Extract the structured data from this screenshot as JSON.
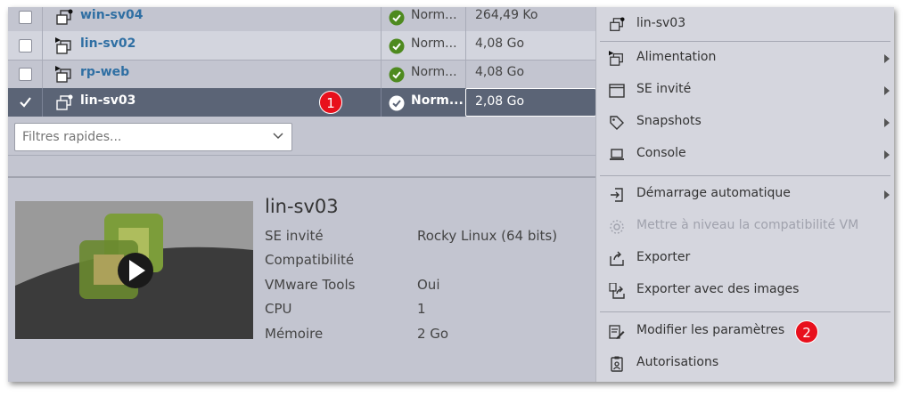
{
  "table": {
    "rows": [
      {
        "name": "win-sv04",
        "status": "Norm...",
        "size": "264,49 Ko",
        "checked": false,
        "selected": false
      },
      {
        "name": "lin-sv02",
        "status": "Norm...",
        "size": "4,08 Go",
        "checked": false,
        "selected": false
      },
      {
        "name": "rp-web",
        "status": "Norm...",
        "size": "4,08 Go",
        "checked": false,
        "selected": false
      },
      {
        "name": "lin-sv03",
        "status": "Norm...",
        "size": "2,08 Go",
        "checked": true,
        "selected": true
      }
    ]
  },
  "filter": {
    "placeholder": "Filtres rapides..."
  },
  "badges": {
    "one": "1",
    "two": "2"
  },
  "detail": {
    "title": "lin-sv03",
    "fields": [
      {
        "label": "SE invité",
        "value": "Rocky Linux (64 bits)"
      },
      {
        "label": "Compatibilité",
        "value": ""
      },
      {
        "label": "VMware Tools",
        "value": "Oui"
      },
      {
        "label": "CPU",
        "value": "1"
      },
      {
        "label": "Mémoire",
        "value": "2 Go"
      }
    ]
  },
  "menu": {
    "header": "lin-sv03",
    "items": [
      {
        "label": "Alimentation",
        "icon": "power-vm-icon",
        "submenu": true,
        "disabled": false
      },
      {
        "label": "SE invité",
        "icon": "window-icon",
        "submenu": true,
        "disabled": false
      },
      {
        "label": "Snapshots",
        "icon": "tag-icon",
        "submenu": true,
        "disabled": false
      },
      {
        "label": "Console",
        "icon": "laptop-icon",
        "submenu": true,
        "disabled": false
      },
      {
        "label": "Démarrage automatique",
        "icon": "login-icon",
        "submenu": true,
        "disabled": false
      },
      {
        "label": "Mettre à niveau la compatibilité VM",
        "icon": "upgrade-icon",
        "submenu": false,
        "disabled": true
      },
      {
        "label": "Exporter",
        "icon": "export-icon",
        "submenu": false,
        "disabled": false
      },
      {
        "label": "Exporter avec des images",
        "icon": "export-images-icon",
        "submenu": false,
        "disabled": false
      },
      {
        "label": "Modifier les paramètres",
        "icon": "edit-settings-icon",
        "submenu": false,
        "disabled": false
      },
      {
        "label": "Autorisations",
        "icon": "permissions-icon",
        "submenu": false,
        "disabled": false
      }
    ]
  },
  "colors": {
    "accent_link": "#2f6fa3",
    "selected_row": "#5b6476",
    "status_ok": "#4e8a1f",
    "badge": "#e8101c"
  }
}
